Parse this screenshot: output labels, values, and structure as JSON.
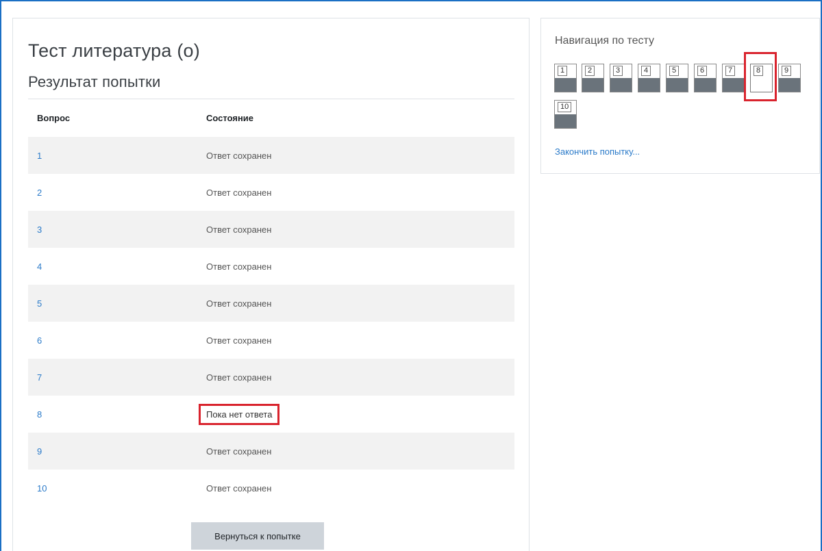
{
  "quiz": {
    "title": "Тест литература (о)",
    "subtitle": "Результат попытки"
  },
  "table": {
    "headers": {
      "question": "Вопрос",
      "state": "Состояние"
    },
    "rows": [
      {
        "num": "1",
        "state": "Ответ сохранен"
      },
      {
        "num": "2",
        "state": "Ответ сохранен"
      },
      {
        "num": "3",
        "state": "Ответ сохранен"
      },
      {
        "num": "4",
        "state": "Ответ сохранен"
      },
      {
        "num": "5",
        "state": "Ответ сохранен"
      },
      {
        "num": "6",
        "state": "Ответ сохранен"
      },
      {
        "num": "7",
        "state": "Ответ сохранен"
      },
      {
        "num": "8",
        "state": "Пока нет ответа"
      },
      {
        "num": "9",
        "state": "Ответ сохранен"
      },
      {
        "num": "10",
        "state": "Ответ сохранен"
      }
    ]
  },
  "return_button": "Вернуться к попытке",
  "navigation": {
    "title": "Навигация по тесту",
    "buttons": [
      {
        "num": "1",
        "answered": true
      },
      {
        "num": "2",
        "answered": true
      },
      {
        "num": "3",
        "answered": true
      },
      {
        "num": "4",
        "answered": true
      },
      {
        "num": "5",
        "answered": true
      },
      {
        "num": "6",
        "answered": true
      },
      {
        "num": "7",
        "answered": true
      },
      {
        "num": "8",
        "answered": false
      },
      {
        "num": "9",
        "answered": true
      },
      {
        "num": "10",
        "answered": true
      }
    ],
    "finish_link": "Закончить попытку..."
  },
  "colors": {
    "link": "#2a7ac9",
    "highlight": "#d9232d",
    "answered_fill": "#6a737b",
    "stripe": "#f2f2f2",
    "frame": "#1a6fc4"
  }
}
